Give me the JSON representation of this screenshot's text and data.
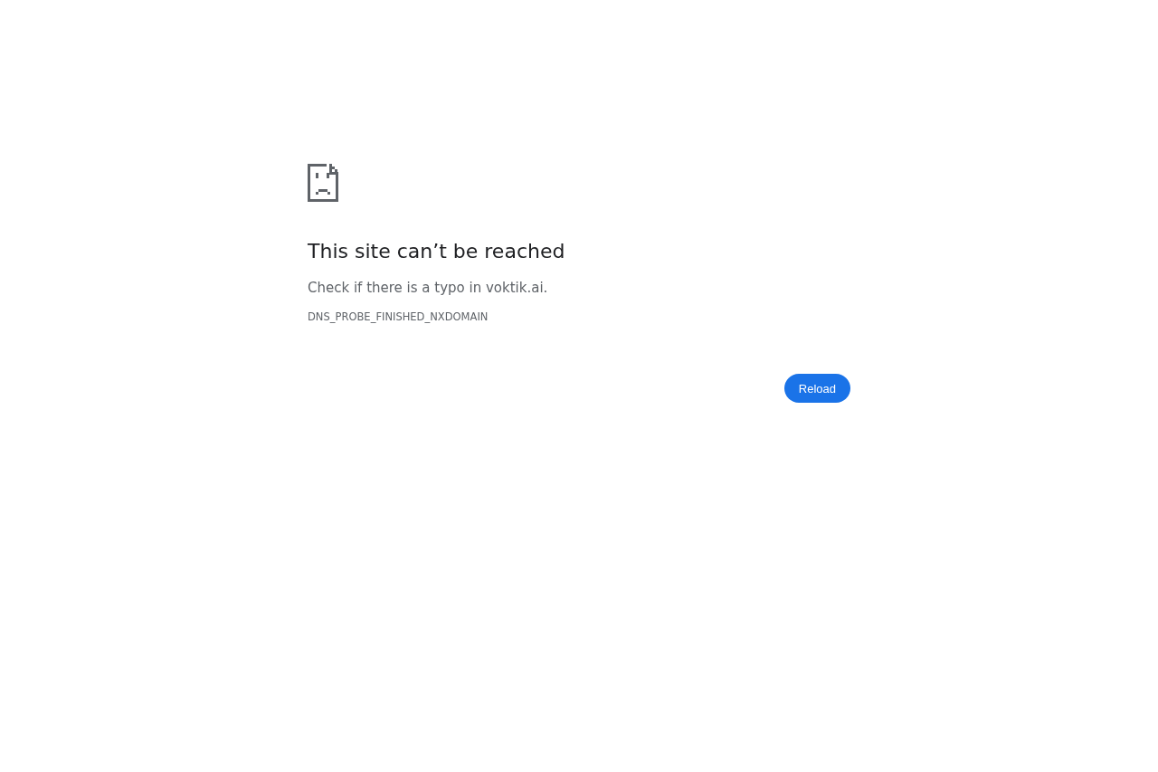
{
  "heading": "This site can’t be reached",
  "message": "Check if there is a typo in voktik.ai.",
  "error_code": "DNS_PROBE_FINISHED_NXDOMAIN",
  "buttons": [
    "Reload"
  ]
}
